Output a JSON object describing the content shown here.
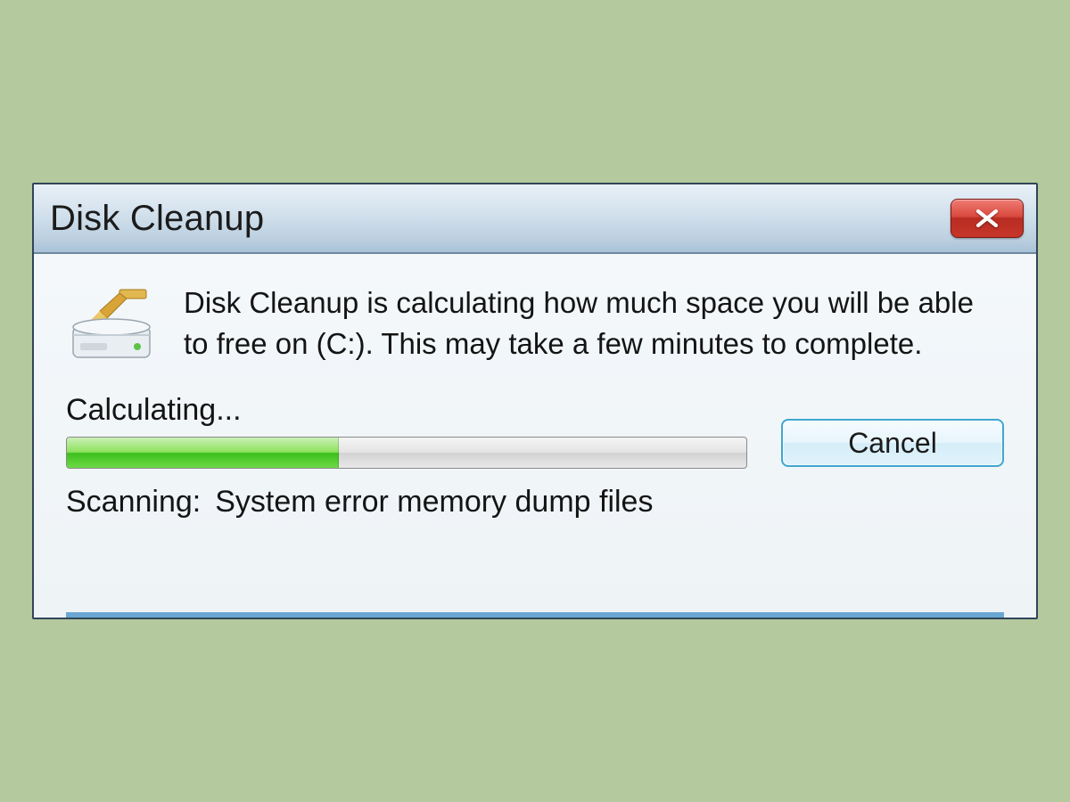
{
  "dialog": {
    "title": "Disk Cleanup",
    "message": "Disk Cleanup is calculating how much space you will be able to free on  (C:). This may take a few minutes to complete.",
    "status_label": "Calculating...",
    "cancel_label": "Cancel",
    "scan_label": "Scanning:",
    "scan_target": "System error memory dump files",
    "progress_percent": 40
  },
  "icons": {
    "close": "close-icon",
    "drive": "disk-cleanup-drive-icon"
  }
}
